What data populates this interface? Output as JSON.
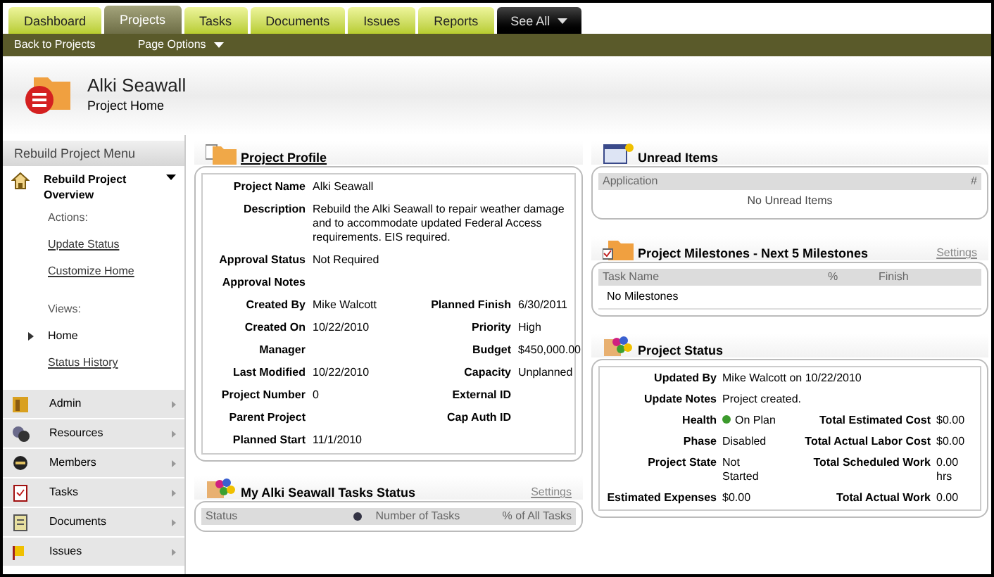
{
  "tabs": [
    {
      "label": "Dashboard",
      "selected": false,
      "kind": "tab"
    },
    {
      "label": "Projects",
      "selected": true,
      "kind": "tab"
    },
    {
      "label": "Tasks",
      "selected": false,
      "kind": "tab"
    },
    {
      "label": "Documents",
      "selected": false,
      "kind": "tab"
    },
    {
      "label": "Issues",
      "selected": false,
      "kind": "tab"
    },
    {
      "label": "Reports",
      "selected": false,
      "kind": "tab"
    },
    {
      "label": "See All",
      "selected": false,
      "kind": "menu"
    }
  ],
  "subnav": [
    {
      "label": "Back to Projects",
      "dropdown": false
    },
    {
      "label": "Page Options",
      "dropdown": true
    }
  ],
  "header": {
    "title": "Alki Seawall",
    "subtitle": "Project Home"
  },
  "sidebar": {
    "title": "Rebuild Project Menu",
    "overview": {
      "label": "Rebuild Project Overview",
      "expanded": true
    },
    "actions_label": "Actions:",
    "actions": [
      "Update Status",
      "Customize Home"
    ],
    "views_label": "Views:",
    "views": [
      {
        "label": "Home",
        "selected": true
      },
      {
        "label": "Status History",
        "selected": false
      }
    ],
    "modules": [
      "Admin",
      "Resources",
      "Members",
      "Tasks",
      "Documents",
      "Issues"
    ]
  },
  "profile": {
    "title": "Project Profile",
    "rows": [
      {
        "label": "Project Name",
        "value": "Alki Seawall"
      },
      {
        "label": "Description",
        "value": "Rebuild the Alki Seawall to repair weather damage and to accommodate updated Federal Access requirements. EIS required."
      },
      {
        "label": "Approval Status",
        "value": "Not Required"
      },
      {
        "label": "Approval Notes"
      },
      {
        "label": "Created By",
        "value": "Mike Walcott",
        "label_2": "Planned Finish",
        "value_2": "6/30/2011"
      },
      {
        "label": "Created On",
        "value": "10/22/2010",
        "label_2": "Priority",
        "value_2": "High"
      },
      {
        "label": "Manager",
        "label_2": "Budget",
        "value_2": "$450,000.00"
      },
      {
        "label": "Last Modified",
        "value": "10/22/2010",
        "label_2": "Capacity",
        "value_2": "Unplanned"
      },
      {
        "label": "Project Number",
        "value": "0",
        "label_2": "External ID"
      },
      {
        "label": "Parent Project",
        "label_2": "Cap Auth ID"
      },
      {
        "label": "Planned Start",
        "value": "11/1/2010"
      }
    ]
  },
  "tasks_status": {
    "title": "My Alki Seawall Tasks Status",
    "settings": "Settings",
    "columns": [
      "Status",
      "Number of Tasks",
      "% of All Tasks"
    ]
  },
  "unread": {
    "title": "Unread Items",
    "columns": [
      "Application",
      "#"
    ],
    "empty": "No Unread Items"
  },
  "milestones": {
    "title": "Project Milestones - Next 5 Milestones",
    "settings": "Settings",
    "columns": [
      "Task Name",
      "%",
      "Finish"
    ],
    "rows": [
      "No Milestones"
    ]
  },
  "status": {
    "title": "Project Status",
    "rows": [
      {
        "label": "Updated By",
        "value": "Mike Walcott on 10/22/2010"
      },
      {
        "label": "Update Notes",
        "value": "Project created."
      },
      {
        "label": "Health",
        "value": "On Plan",
        "color": "#3c9a2c",
        "label_2": "Total Estimated Cost",
        "value_2": "$0.00"
      },
      {
        "label": "Phase",
        "value": "Disabled",
        "label_2": "Total Actual Labor Cost",
        "value_2": "$0.00"
      },
      {
        "label": "Project State",
        "value": "Not Started",
        "label_2": "Total Scheduled Work",
        "value_2": "0.00 hrs"
      },
      {
        "label": "Estimated Expenses",
        "value": "$0.00",
        "label_2": "Total Actual Work",
        "value_2": "0.00"
      }
    ]
  }
}
